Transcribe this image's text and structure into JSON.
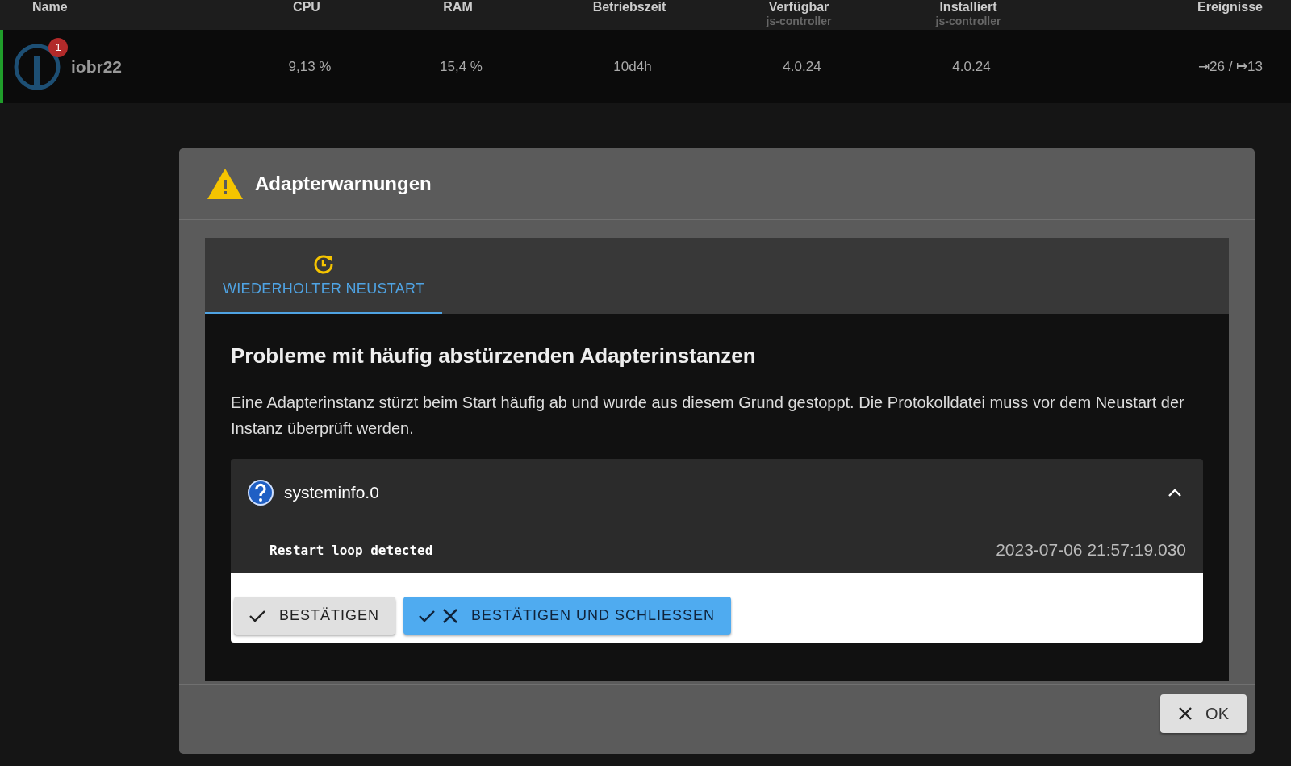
{
  "table": {
    "columns": [
      {
        "label": "Name"
      },
      {
        "label": "CPU"
      },
      {
        "label": "RAM"
      },
      {
        "label": "Betriebszeit"
      },
      {
        "label": "Verfügbar",
        "sublabel": "js-controller"
      },
      {
        "label": "Installiert",
        "sublabel": "js-controller"
      },
      {
        "label": "Ereignisse"
      }
    ],
    "rows": [
      {
        "name": "iobr22",
        "badge": "1",
        "cpu": "9,13 %",
        "ram": "15,4 %",
        "uptime": "10d4h",
        "available": "4.0.24",
        "installed": "4.0.24",
        "events": "⇥26 / ↦13"
      }
    ]
  },
  "dialog": {
    "title": "Adapterwarnungen",
    "tabs": [
      {
        "label": "WIEDERHOLTER NEUSTART",
        "selected": true
      }
    ],
    "heading": "Probleme mit häufig abstürzenden Adapterinstanzen",
    "description": "Eine Adapterinstanz stürzt beim Start häufig ab und wurde aus diesem Grund gestoppt. Die Protokolldatei muss vor dem Neustart der Instanz überprüft werden.",
    "instances": [
      {
        "name": "systeminfo.0",
        "expanded": true,
        "messages": [
          {
            "text": "Restart loop detected",
            "time": "2023-07-06 21:57:19.030"
          }
        ]
      }
    ],
    "actions": [
      {
        "label": "BESTÄTIGEN",
        "kind": "confirm"
      },
      {
        "label": "BESTÄTIGEN UND SCHLIESSEN",
        "kind": "confirm-close"
      }
    ],
    "ok_button": "OK"
  }
}
